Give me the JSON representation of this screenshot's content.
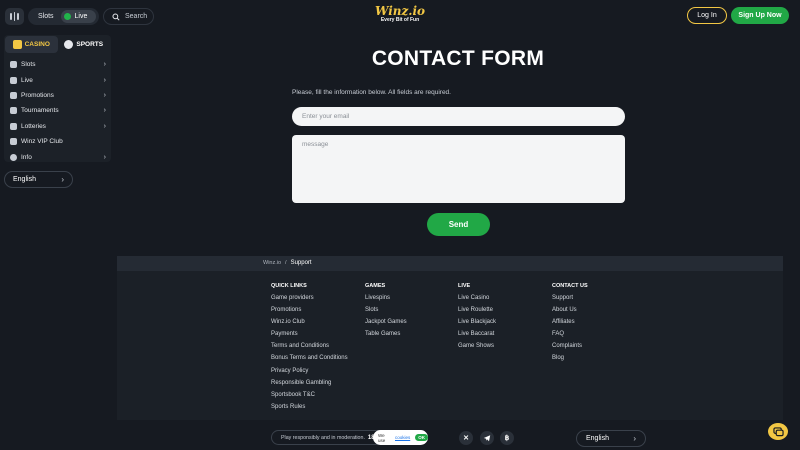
{
  "header": {
    "mode_slots": "Slots",
    "mode_live": "Live",
    "search_label": "Search",
    "logo_main": "Winz.io",
    "logo_tagline": "Every Bit of Fun",
    "login_label": "Log In",
    "signup_label": "Sign Up Now"
  },
  "sidebar": {
    "tabs": [
      {
        "label": "CASINO"
      },
      {
        "label": "SPORTS"
      }
    ],
    "items": [
      {
        "label": "Slots",
        "icon": "slots-icon"
      },
      {
        "label": "Live",
        "icon": "live-icon"
      },
      {
        "label": "Promotions",
        "icon": "promotions-icon"
      },
      {
        "label": "Tournaments",
        "icon": "trophy-icon"
      },
      {
        "label": "Lotteries",
        "icon": "lotteries-icon"
      },
      {
        "label": "Winz VIP Club",
        "icon": "vip-icon"
      },
      {
        "label": "Info",
        "icon": "info-icon"
      }
    ],
    "language": "English"
  },
  "main": {
    "title": "CONTACT FORM",
    "subtitle": "Please, fill the information below. All fields are required.",
    "email_placeholder": "Enter your email",
    "message_placeholder": "message",
    "send_label": "Send"
  },
  "breadcrumb": {
    "home": "Winz.io",
    "separator": "/",
    "current": "Support"
  },
  "footer": {
    "columns": [
      {
        "heading": "QUICK LINKS",
        "links": [
          "Game providers",
          "Promotions",
          "Winz.io Club",
          "Payments",
          "Terms and Conditions",
          "Bonus Terms and Conditions",
          "Privacy Policy",
          "Responsible Gambling",
          "Sportsbook T&C",
          "Sports Rules"
        ]
      },
      {
        "heading": "GAMES",
        "links": [
          "Livespins",
          "Slots",
          "Jackpot Games",
          "Table Games"
        ]
      },
      {
        "heading": "LIVE",
        "links": [
          "Live Casino",
          "Live Roulette",
          "Live Blackjack",
          "Live Baccarat",
          "Game Shows"
        ]
      },
      {
        "heading": "CONTACT US",
        "links": [
          "Support",
          "About Us",
          "Affiliates",
          "FAQ",
          "Complaints",
          "Blog"
        ]
      }
    ],
    "responsible": "Play responsibly and in moderation.",
    "age_badge": "18",
    "cookie_prefix": "We use",
    "cookie_link": "cookies",
    "cookie_ok": "OK",
    "social": [
      "x-icon",
      "telegram-icon",
      "bitcoin-icon"
    ],
    "language": "English"
  },
  "colors": {
    "background": "#161a21",
    "accent_yellow": "#f2c744",
    "accent_green": "#21a846"
  }
}
